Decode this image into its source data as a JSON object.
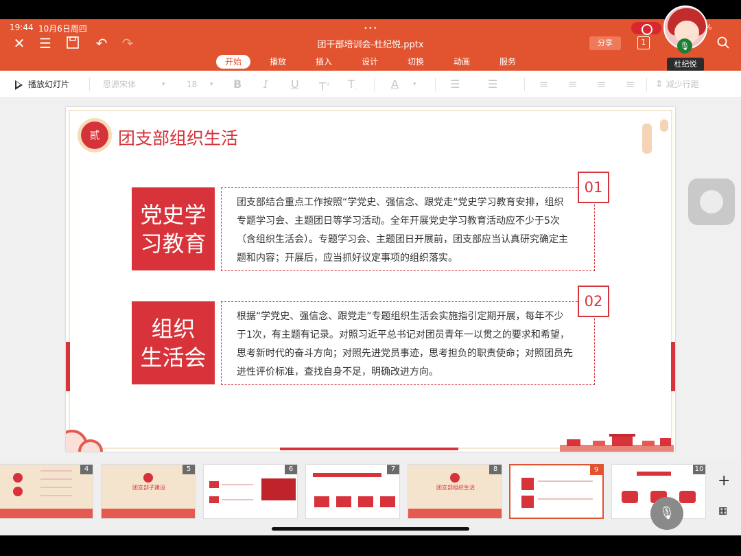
{
  "status": {
    "time": "19:44",
    "date": "10月6日周四",
    "battery": "3%"
  },
  "titlebar": {
    "document_title": "团干部培训会-杜纪悦.pptx",
    "share_label": "分享",
    "page_indicator": "1",
    "user_name": "杜纪悦"
  },
  "tabs": [
    {
      "label": "开始",
      "active": true
    },
    {
      "label": "播放"
    },
    {
      "label": "插入"
    },
    {
      "label": "设计"
    },
    {
      "label": "切换"
    },
    {
      "label": "动画"
    },
    {
      "label": "服务"
    }
  ],
  "toolbar": {
    "play_slideshow": "播放幻灯片",
    "font_name": "思源宋体",
    "font_size": "18",
    "reduce_spacing": "减少行距"
  },
  "slide": {
    "badge": "贰",
    "title": "团支部组织生活",
    "sections": [
      {
        "heading_line1": "党史学",
        "heading_line2": "习教育",
        "number": "01",
        "body": "团支部结合重点工作按照“学党史、强信念、跟党走”党史学习教育安排，组织专题学习会、主题团日等学习活动。全年开展党史学习教育活动应不少于5次（含组织生活会）。专题学习会、主题团日开展前，团支部应当认真研究确定主题和内容；开展后，应当抓好议定事项的组织落实。"
      },
      {
        "heading_line1": "组织",
        "heading_line2": "生活会",
        "number": "02",
        "body": "根据“学党史、强信念、跟党走”专题组织生活会实施指引定期开展，每年不少于1次，有主题有记录。对照习近平总书记对团员青年一以贯之的要求和希望，思考新时代的奋斗方向；对照先进党员事迹，思考担负的职责使命；对照团员先进性评价标准，查找自身不足，明确改进方向。"
      }
    ]
  },
  "thumbnails": [
    {
      "number": "4"
    },
    {
      "number": "5",
      "title": "团支部子建设"
    },
    {
      "number": "6"
    },
    {
      "number": "7"
    },
    {
      "number": "8",
      "title": "团支部组织生活"
    },
    {
      "number": "9",
      "active": true
    },
    {
      "number": "10"
    }
  ],
  "colors": {
    "brand": "#e1542f",
    "accent_red": "#d8333b"
  }
}
